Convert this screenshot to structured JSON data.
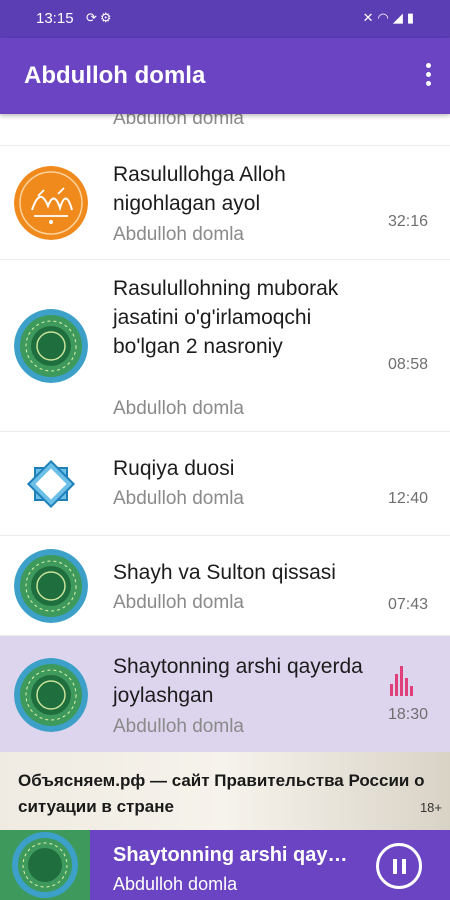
{
  "status_bar": {
    "time": "13:15",
    "left_icons": [
      "sync-icon",
      "settings-icon"
    ],
    "right_icons": [
      "mute-icon",
      "wifi-icon",
      "signal-icon",
      "battery-icon"
    ]
  },
  "app_bar": {
    "title": "Abdulloh domla",
    "menu_icon": "more-vert-icon"
  },
  "tracks": [
    {
      "title": "",
      "author": "Abdulloh domla",
      "duration": "",
      "art": "partial"
    },
    {
      "title": "Rasulullohga Alloh nigohlagan ayol",
      "author": "Abdulloh domla",
      "duration": "32:16",
      "art": "calligraphy-orange"
    },
    {
      "title": "Rasulullohning muborak jasatini o'g'irlamoqchi bo'lgan 2 nasroniy",
      "author": "Abdulloh domla",
      "duration": "08:58",
      "art": "ornament-green"
    },
    {
      "title": "Ruqiya duosi",
      "author": "Abdulloh domla",
      "duration": "12:40",
      "art": "star-blue"
    },
    {
      "title": "Shayh va Sulton qissasi",
      "author": "Abdulloh domla",
      "duration": "07:43",
      "art": "ornament-green"
    },
    {
      "title": "Shaytonning arshi qayerda joylashgan",
      "author": "Abdulloh domla",
      "duration": "18:30",
      "art": "ornament-green",
      "playing": true
    }
  ],
  "ad": {
    "text": "Объясняем.рф — сайт Правительства России о ситуации в стране",
    "age_label": "18+"
  },
  "player": {
    "title": "Shaytonning arshi qayerda joylashgan",
    "subtitle": "Abdulloh domla",
    "button_icon": "pause-icon"
  },
  "colors": {
    "status_bar": "#5b3db4",
    "app_bar": "#6a44c2",
    "active_row": "#ddd5ee",
    "playing_indicator": "#e0407a",
    "medallion_green": "#3d9a5c",
    "medallion_blue": "#3da0c8",
    "calligraphy_orange": "#f08a1d"
  }
}
